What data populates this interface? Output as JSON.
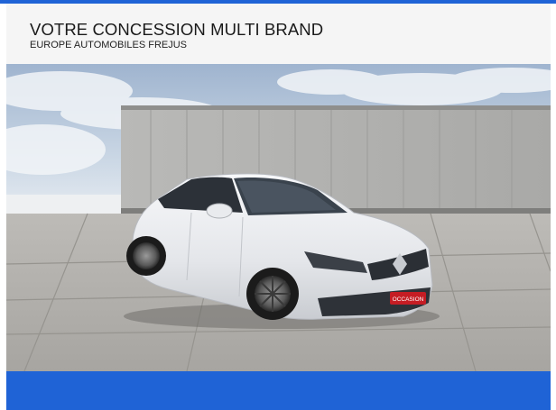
{
  "header": {
    "title": "VOTRE CONCESSION MULTI BRAND",
    "subtitle": "EUROPE AUTOMOBILES FREJUS"
  },
  "photo": {
    "badge_text": "OCCASION"
  },
  "colors": {
    "accent_blue": "#1f63d6",
    "header_bg": "#f5f5f5"
  }
}
